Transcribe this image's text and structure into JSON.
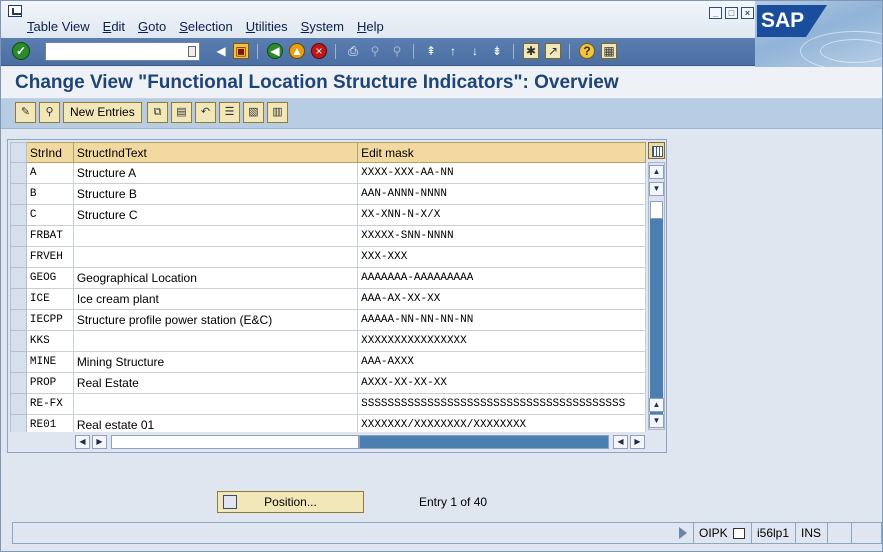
{
  "menu": {
    "items": [
      "Table View",
      "Edit",
      "Goto",
      "Selection",
      "Utilities",
      "System",
      "Help"
    ]
  },
  "logo": {
    "text": "SAP"
  },
  "toolbar": {
    "command_value": "",
    "icons": [
      "enter-icon",
      "back-icon",
      "exit-icon",
      "cancel-icon",
      "save-icon",
      "print-icon",
      "find-icon",
      "find-next-icon",
      "first-page-icon",
      "previous-page-icon",
      "next-page-icon",
      "last-page-icon",
      "create-session-icon",
      "shortcut-icon",
      "help-icon",
      "customize-layout-icon"
    ]
  },
  "title": "Change View \"Functional Location Structure Indicators\": Overview",
  "app_toolbar": {
    "new_entries_label": "New Entries"
  },
  "table": {
    "columns": [
      "StrInd",
      "StructIndText",
      "Edit mask"
    ],
    "rows": [
      {
        "strind": "A",
        "text": "Structure A",
        "mask": "XXXX-XXX-AA-NN"
      },
      {
        "strind": "B",
        "text": "Structure B",
        "mask": "AAN-ANNN-NNNN"
      },
      {
        "strind": "C",
        "text": "Structure C",
        "mask": "XX-XNN-N-X/X"
      },
      {
        "strind": "FRBAT",
        "text": "",
        "mask": "XXXXX-SNN-NNNN"
      },
      {
        "strind": "FRVEH",
        "text": "",
        "mask": "XXX-XXX"
      },
      {
        "strind": "GEOG",
        "text": "Geographical Location",
        "mask": "AAAAAAA-AAAAAAAAA"
      },
      {
        "strind": "ICE",
        "text": "Ice cream plant",
        "mask": "AAA-AX-XX-XX"
      },
      {
        "strind": "IECPP",
        "text": "Structure profile power station (E&C)",
        "mask": "AAAAA-NN-NN-NN-NN"
      },
      {
        "strind": "KKS",
        "text": "",
        "mask": "XXXXXXXXXXXXXXXX"
      },
      {
        "strind": "MINE",
        "text": "Mining Structure",
        "mask": "AAA-AXXX"
      },
      {
        "strind": "PROP",
        "text": "Real Estate",
        "mask": "AXXX-XX-XX-XX"
      },
      {
        "strind": "RE-FX",
        "text": "",
        "mask": "SSSSSSSSSSSSSSSSSSSSSSSSSSSSSSSSSSSSSSSS"
      },
      {
        "strind": "RE01",
        "text": "Real estate 01",
        "mask": "XXXXXXX/XXXXXXXX/XXXXXXXX"
      }
    ]
  },
  "position_button": {
    "label": "Position..."
  },
  "entry_info": "Entry 1 of 40",
  "status": {
    "transaction": "OIPK",
    "server": "i56lp1",
    "mode": "INS"
  }
}
